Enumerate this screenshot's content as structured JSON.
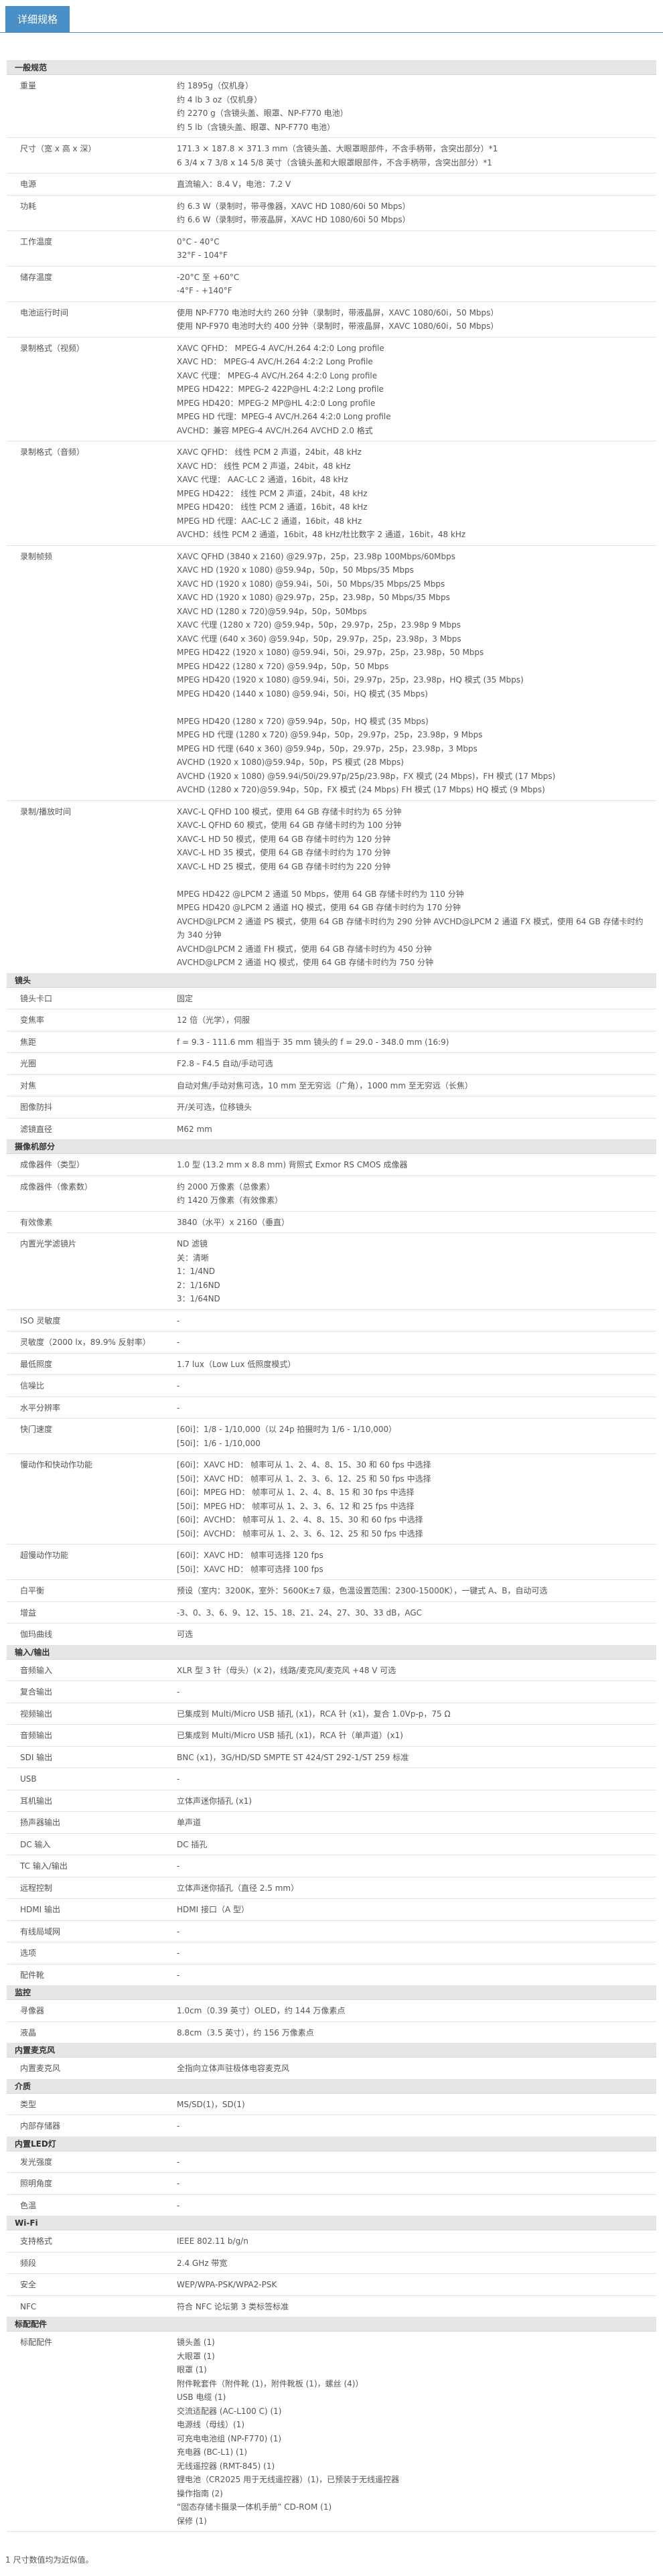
{
  "colors": {
    "accent": "#4a90c8",
    "section_bg": "#e6e6e6"
  },
  "tab": {
    "label": "详细规格"
  },
  "footnote": "1 尺寸数值均为近似值。",
  "sections": [
    {
      "title": "一般规范",
      "rows": [
        {
          "label": "重量",
          "groups": [
            [
              "约 1895g（仅机身）",
              "约 4 lb 3 oz（仅机身）",
              "约 2270 g（含镜头盖、眼罩、NP-F770 电池）",
              "约 5 lb（含镜头盖、眼罩、NP-F770 电池）"
            ]
          ]
        },
        {
          "label": "尺寸（宽 x 高 x 深）",
          "groups": [
            [
              "171.3 × 187.8 × 371.3 mm（含镜头盖、大眼罩眼部件，不含手柄带，含突出部分）*1",
              "6 3/4 x 7 3/8 x 14 5/8 英寸（含镜头盖和大眼罩眼部件，不含手柄带，含突出部分）*1"
            ]
          ]
        },
        {
          "label": "电源",
          "groups": [
            [
              "直流输入：8.4 V，电池：7.2 V"
            ]
          ]
        },
        {
          "label": "功耗",
          "groups": [
            [
              "约 6.3 W（录制时，带寻像器，XAVC HD 1080/60i 50 Mbps）",
              "约 6.6 W（录制时，带液晶屏，XAVC HD 1080/60i 50 Mbps）"
            ]
          ]
        },
        {
          "label": "工作温度",
          "groups": [
            [
              "0°C - 40°C",
              "32°F - 104°F"
            ]
          ]
        },
        {
          "label": "储存温度",
          "groups": [
            [
              "-20°C 至 +60°C",
              "-4°F - +140°F"
            ]
          ]
        },
        {
          "label": "电池运行时间",
          "groups": [
            [
              "使用 NP-F770 电池时大约 260 分钟（录制时，带液晶屏，XAVC 1080/60i，50 Mbps）",
              "使用 NP-F970 电池时大约 400 分钟（录制时，带液晶屏，XAVC 1080/60i，50 Mbps）"
            ]
          ]
        },
        {
          "label": "录制格式（视频）",
          "groups": [
            [
              "XAVC QFHD： MPEG-4 AVC/H.264 4:2:0 Long profile",
              "XAVC HD： MPEG-4 AVC/H.264 4:2:2 Long Profile",
              "XAVC 代理： MPEG-4 AVC/H.264 4:2:0 Long profile",
              "MPEG HD422：MPEG-2 422P@HL 4:2:2 Long profile",
              "MPEG HD420：MPEG-2 MP@HL 4:2:0 Long profile",
              "MPEG HD 代理：MPEG-4 AVC/H.264 4:2:0 Long profile",
              "AVCHD：兼容 MPEG-4 AVC/H.264 AVCHD 2.0 格式"
            ]
          ]
        },
        {
          "label": "录制格式（音频）",
          "groups": [
            [
              "XAVC QFHD： 线性 PCM 2 声道，24bit，48 kHz",
              "XAVC HD： 线性 PCM 2 声道，24bit，48 kHz",
              "XAVC 代理： AAC-LC 2 通道，16bit，48 kHz",
              "MPEG HD422： 线性 PCM 2 声道，24bit，48 kHz",
              "MPEG HD420： 线性 PCM 2 通道，16bit，48 kHz",
              "MPEG HD 代理：AAC-LC 2 通道，16bit，48 kHz",
              "AVCHD：线性 PCM 2 通道，16bit，48 kHz/杜比数字 2 通道，16bit，48 kHz"
            ]
          ]
        },
        {
          "label": "录制帧频",
          "groups": [
            [
              "XAVC QFHD (3840 x 2160) @29.97p，25p，23.98p 100Mbps/60Mbps",
              "XAVC HD (1920 x 1080) @59.94p，50p，50 Mbps/35 Mbps",
              "XAVC HD (1920 x 1080) @59.94i，50i，50 Mbps/35 Mbps/25 Mbps",
              "XAVC HD (1920 x 1080) @29.97p，25p，23.98p，50 Mbps/35 Mbps",
              "XAVC HD (1280 x 720)@59.94p，50p，50Mbps",
              "XAVC 代理 (1280 x 720) @59.94p，50p，29.97p，25p，23.98p 9 Mbps",
              "XAVC 代理 (640 x 360) @59.94p，50p，29.97p，25p，23.98p，3 Mbps",
              "MPEG HD422 (1920 x 1080) @59.94i，50i，29.97p，25p，23.98p，50 Mbps",
              "MPEG HD422 (1280 x 720) @59.94p，50p，50 Mbps",
              "MPEG HD420 (1920 x 1080) @59.94i，50i，29.97p，25p，23.98p，HQ 模式 (35 Mbps)",
              "MPEG HD420 (1440 x 1080) @59.94i，50i，HQ 模式 (35 Mbps)"
            ],
            [
              "MPEG HD420 (1280 x 720) @59.94p，50p，HQ 模式 (35 Mbps)",
              "MPEG HD 代理 (1280 x 720) @59.94p，50p，29.97p，25p，23.98p，9 Mbps",
              "MPEG HD 代理 (640 x 360) @59.94p，50p，29.97p，25p，23.98p，3 Mbps",
              "AVCHD (1920 x 1080)@59.94p，50p，PS 模式 (28 Mbps)",
              "AVCHD (1920 x 1080) @59.94i/50i/29.97p/25p/23.98p，FX 模式 (24 Mbps)，FH 模式 (17 Mbps)",
              "AVCHD (1280 x 720)@59.94p，50p，FX 模式 (24 Mbps) FH 模式 (17 Mbps) HQ 模式 (9 Mbps)"
            ]
          ]
        },
        {
          "label": "录制/播放时间",
          "groups": [
            [
              "XAVC-L QFHD 100 模式，使用 64 GB 存储卡时约为 65 分钟",
              "XAVC-L QFHD 60 模式，使用 64 GB 存储卡时约为 100 分钟",
              "XAVC-L HD 50 模式，使用 64 GB 存储卡时约为 120 分钟",
              "XAVC-L HD 35 模式，使用 64 GB 存储卡时约为 170 分钟",
              "XAVC-L HD 25 模式，使用 64 GB 存储卡时约为 220 分钟"
            ],
            [
              "MPEG HD422 @LPCM 2 通道 50 Mbps，使用 64 GB 存储卡时约为 110 分钟",
              "MPEG HD420 @LPCM 2 通道 HQ 模式，使用 64 GB 存储卡时约为 170 分钟",
              "AVCHD@LPCM 2 通道 PS 模式，使用 64 GB 存储卡时约为 290 分钟 AVCHD@LPCM 2 通道 FX 模式，使用 64 GB 存储卡时约为 340 分钟",
              "AVCHD@LPCM 2 通道 FH 模式，使用 64 GB 存储卡时约为 450 分钟",
              "AVCHD@LPCM 2 通道 HQ 模式，使用 64 GB 存储卡时约为 750 分钟"
            ]
          ]
        }
      ]
    },
    {
      "title": "镜头",
      "rows": [
        {
          "label": "镜头卡口",
          "groups": [
            [
              "固定"
            ]
          ]
        },
        {
          "label": "变焦率",
          "groups": [
            [
              "12 倍（光学），伺服"
            ]
          ]
        },
        {
          "label": "焦距",
          "groups": [
            [
              "f = 9.3 - 111.6 mm 相当于 35 mm 镜头的 f = 29.0 - 348.0 mm (16:9)"
            ]
          ]
        },
        {
          "label": "光圈",
          "groups": [
            [
              "F2.8 - F4.5 自动/手动可选"
            ]
          ]
        },
        {
          "label": "对焦",
          "groups": [
            [
              "自动对焦/手动对焦可选，10 mm 至无穷远（广角），1000 mm 至无穷远（长焦）"
            ]
          ]
        },
        {
          "label": "图像防抖",
          "groups": [
            [
              "开/关可选，位移镜头"
            ]
          ]
        },
        {
          "label": "滤镜直径",
          "groups": [
            [
              "M62 mm"
            ]
          ]
        }
      ]
    },
    {
      "title": "摄像机部分",
      "rows": [
        {
          "label": "成像器件（类型）",
          "groups": [
            [
              "1.0 型 (13.2 mm x 8.8 mm) 背照式 Exmor RS CMOS 成像器"
            ]
          ]
        },
        {
          "label": "成像器件（像素数）",
          "groups": [
            [
              "约 2000 万像素（总像素）",
              "约 1420 万像素（有效像素）"
            ]
          ]
        },
        {
          "label": "有效像素",
          "groups": [
            [
              "3840（水平）x 2160（垂直）"
            ]
          ]
        },
        {
          "label": "内置光学滤镜片",
          "groups": [
            [
              "ND 滤镜",
              "关：清晰",
              "1：1/4ND",
              "2：1/16ND",
              "3：1/64ND"
            ]
          ]
        },
        {
          "label": "ISO 灵敏度",
          "groups": [
            [
              "-"
            ]
          ]
        },
        {
          "label": "灵敏度（2000 lx，89.9% 反射率）",
          "groups": [
            [
              "-"
            ]
          ]
        },
        {
          "label": "最低照度",
          "groups": [
            [
              "1.7 lux（Low Lux 低照度模式）"
            ]
          ]
        },
        {
          "label": "信噪比",
          "groups": [
            [
              "-"
            ]
          ]
        },
        {
          "label": "水平分辨率",
          "groups": [
            [
              "-"
            ]
          ]
        },
        {
          "label": "快门速度",
          "groups": [
            [
              "[60i]：1/8 - 1/10,000（以 24p 拍摄时为 1/6 - 1/10,000）",
              "[50i]：1/6 - 1/10,000"
            ]
          ]
        },
        {
          "label": "慢动作和快动作功能",
          "groups": [
            [
              "[60i]：XAVC HD： 帧率可从 1、2、4、8、15、30 和 60 fps 中选择",
              "[50i]：XAVC HD： 帧率可从 1、2、3、6、12、25 和 50 fps 中选择",
              "[60i]：MPEG HD： 帧率可从 1、2、4、8、15 和 30 fps 中选择",
              "[50i]：MPEG HD： 帧率可从 1、2、3、6、12 和 25 fps 中选择",
              "[60i]：AVCHD： 帧率可从 1、2、4、8、15、30 和 60 fps 中选择",
              "[50i]：AVCHD： 帧率可从 1、2、3、6、12、25 和 50 fps 中选择"
            ]
          ]
        },
        {
          "label": "超慢动作功能",
          "groups": [
            [
              "[60i]：XAVC HD： 帧率可选择 120 fps",
              "[50i]：XAVC HD： 帧率可选择 100 fps"
            ]
          ]
        },
        {
          "label": "白平衡",
          "groups": [
            [
              "预设（室内：3200K，室外：5600K±7 级，色温设置范围：2300-15000K），一键式 A、B，自动可选"
            ]
          ]
        },
        {
          "label": "增益",
          "groups": [
            [
              "-3、0、3、6、9、12、15、18、21、24、27、30、33 dB，AGC"
            ]
          ]
        },
        {
          "label": "伽玛曲线",
          "groups": [
            [
              "可选"
            ]
          ]
        }
      ]
    },
    {
      "title": "输入/输出",
      "rows": [
        {
          "label": "音频输入",
          "groups": [
            [
              "XLR 型 3 针（母头）(x 2)，线路/麦克风/麦克风 +48 V 可选"
            ]
          ]
        },
        {
          "label": "复合输出",
          "groups": [
            [
              "-"
            ]
          ]
        },
        {
          "label": "视频输出",
          "groups": [
            [
              "已集成到 Multi/Micro USB 插孔 (x1)，RCA 针 (x1)，复合 1.0Vp-p，75 Ω"
            ]
          ]
        },
        {
          "label": "音频输出",
          "groups": [
            [
              "已集成到 Multi/Micro USB 插孔 (x1)，RCA 针（单声道）(x1)"
            ]
          ]
        },
        {
          "label": "SDI 输出",
          "groups": [
            [
              "BNC (x1)，3G/HD/SD SMPTE ST 424/ST 292-1/ST 259 标准"
            ]
          ]
        },
        {
          "label": "USB",
          "groups": [
            [
              "-"
            ]
          ]
        },
        {
          "label": "耳机输出",
          "groups": [
            [
              "立体声迷你插孔 (x1)"
            ]
          ]
        },
        {
          "label": "扬声器输出",
          "groups": [
            [
              "单声道"
            ]
          ]
        },
        {
          "label": "DC 输入",
          "groups": [
            [
              "DC 插孔"
            ]
          ]
        },
        {
          "label": "TC 输入/输出",
          "groups": [
            [
              "-"
            ]
          ]
        },
        {
          "label": "远程控制",
          "groups": [
            [
              "立体声迷你插孔（直径 2.5 mm）"
            ]
          ]
        },
        {
          "label": "HDMI 输出",
          "groups": [
            [
              "HDMI 接口（A 型）"
            ]
          ]
        },
        {
          "label": "有线局域网",
          "groups": [
            [
              "-"
            ]
          ]
        },
        {
          "label": "选项",
          "groups": [
            [
              "-"
            ]
          ]
        },
        {
          "label": "配件靴",
          "groups": [
            [
              "-"
            ]
          ]
        }
      ]
    },
    {
      "title": "监控",
      "rows": [
        {
          "label": "寻像器",
          "groups": [
            [
              "1.0cm（0.39 英寸）OLED，约 144 万像素点"
            ]
          ]
        },
        {
          "label": "液晶",
          "groups": [
            [
              "8.8cm（3.5 英寸），约 156 万像素点"
            ]
          ]
        }
      ]
    },
    {
      "title": "内置麦克风",
      "rows": [
        {
          "label": "内置麦克风",
          "groups": [
            [
              "全指向立体声驻极体电容麦克风"
            ]
          ]
        }
      ]
    },
    {
      "title": "介质",
      "rows": [
        {
          "label": "类型",
          "groups": [
            [
              "MS/SD(1)，SD(1)"
            ]
          ]
        },
        {
          "label": "内部存储器",
          "groups": [
            [
              "-"
            ]
          ]
        }
      ]
    },
    {
      "title": "内置LED灯",
      "rows": [
        {
          "label": "发光强度",
          "groups": [
            [
              "-"
            ]
          ]
        },
        {
          "label": "照明角度",
          "groups": [
            [
              "-"
            ]
          ]
        },
        {
          "label": "色温",
          "groups": [
            [
              "-"
            ]
          ]
        }
      ]
    },
    {
      "title": "Wi-Fi",
      "rows": [
        {
          "label": "支持格式",
          "groups": [
            [
              "IEEE 802.11 b/g/n"
            ]
          ]
        },
        {
          "label": "频段",
          "groups": [
            [
              "2.4 GHz 带宽"
            ]
          ]
        },
        {
          "label": "安全",
          "groups": [
            [
              "WEP/WPA-PSK/WPA2-PSK"
            ]
          ]
        },
        {
          "label": "NFC",
          "groups": [
            [
              "符合 NFC 论坛第 3 类标签标准"
            ]
          ]
        }
      ]
    },
    {
      "title": "标配配件",
      "rows": [
        {
          "label": "标配配件",
          "groups": [
            [
              "镜头盖 (1)",
              "大眼罩 (1)",
              "眼罩 (1)",
              "附件靴套件（附件靴 (1)，附件靴板 (1)，螺丝 (4)）",
              "USB 电缆 (1)",
              "交流适配器 (AC-L100 C) (1)",
              "电源线（母线）(1)",
              "可充电电池组 (NP-F770) (1)",
              "充电器 (BC-L1) (1)",
              "无线遥控器 (RMT-845) (1)",
              "锂电池（CR2025 用于无线遥控器）(1)，已预装于无线遥控器",
              "操作指南 (2)",
              "“固态存储卡摄录一体机手册” CD-ROM (1)",
              "保修 (1)"
            ]
          ]
        }
      ]
    }
  ]
}
